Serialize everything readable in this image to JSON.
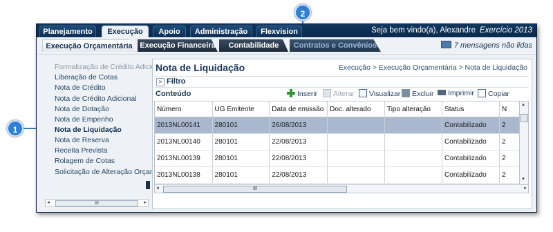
{
  "topnav": {
    "tabs": [
      {
        "label": "Planejamento",
        "active": false
      },
      {
        "label": "Execução",
        "active": true
      },
      {
        "label": "Apoio",
        "active": false
      },
      {
        "label": "Administração",
        "active": false
      },
      {
        "label": "Flexvision",
        "active": false
      }
    ],
    "welcome": "Seja bem vindo(a), Alexandre",
    "exercicio": "Exercício 2013"
  },
  "subnav": {
    "tabs": [
      {
        "label": "Execução Orçamentária",
        "active": true
      },
      {
        "label": "Execução Financeira",
        "active": false
      },
      {
        "label": "Contabilidade",
        "active": false
      },
      {
        "label": "Contratos e Convênios",
        "active": false
      }
    ],
    "messages": "7 mensagens não lidas"
  },
  "sidebar": {
    "items": [
      "Formalização de Crédito Adicional",
      "Liberação de Cotas",
      "Nota de Crédito",
      "Nota de Crédito Adicional",
      "Nota de Dotação",
      "Nota de Empenho",
      "Nota de Liquidação",
      "Nota de Reserva",
      "Receita Prevista",
      "Rolagem de Cotas",
      "Solicitação de Alteração Orçament"
    ],
    "active_index": 6,
    "scroll_label": "III"
  },
  "panel": {
    "title": "Nota de Liquidação",
    "breadcrumb": "Execução > Execução Orçamentária > Nota de Liquidação",
    "filter_label": "Filtro",
    "content_label": "Conteúdo",
    "toolbar": {
      "inserir": "Inserir",
      "alterar": "Alterar",
      "visualizar": "Visualizar",
      "excluir": "Excluir",
      "imprimir": "Imprimir",
      "copiar": "Copiar"
    },
    "table": {
      "columns": [
        "Número",
        "UG Emitente",
        "Data de emissão",
        "Doc. alterado",
        "Tipo alteração",
        "Status",
        "N"
      ],
      "rows": [
        [
          "2013NL00141",
          "280101",
          "26/08/2013",
          "",
          "",
          "Contabilizado",
          "2"
        ],
        [
          "2013NL00140",
          "280101",
          "22/08/2013",
          "",
          "",
          "Contabilizado",
          "2"
        ],
        [
          "2013NL00139",
          "280101",
          "22/08/2013",
          "",
          "",
          "Contabilizado",
          "2"
        ],
        [
          "2013NL00138",
          "280101",
          "22/08/2013",
          "",
          "",
          "Contabilizado",
          "2"
        ]
      ],
      "selected_row": 0
    },
    "hscroll_label": "III"
  },
  "callouts": {
    "one": "1",
    "two": "2"
  },
  "colors": {
    "nav_dark": "#0b2a4e",
    "callout": "#2f7fd4",
    "selected_row": "#a9b8cf"
  }
}
